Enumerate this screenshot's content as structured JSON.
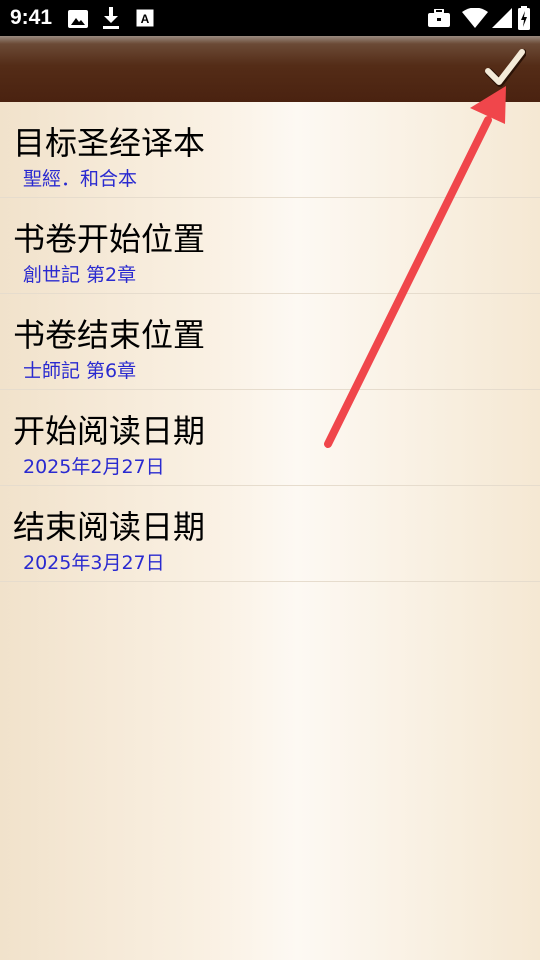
{
  "status_bar": {
    "time": "9:41",
    "left_icons": [
      "image-icon",
      "download-icon",
      "font-a-icon"
    ],
    "right_icons": [
      "briefcase-icon",
      "wifi-icon",
      "cell-signal-icon",
      "battery-charging-icon"
    ]
  },
  "toolbar": {
    "confirm_icon": "check-icon"
  },
  "settings": [
    {
      "title": "目标圣经译本",
      "value": "聖經．和合本"
    },
    {
      "title": "书卷开始位置",
      "value": "創世記 第2章"
    },
    {
      "title": "书卷结束位置",
      "value": "士師記 第6章"
    },
    {
      "title": "开始阅读日期",
      "value": "2025年2月27日"
    },
    {
      "title": "结束阅读日期",
      "value": "2025年3月27日"
    }
  ],
  "colors": {
    "appbar": "#4a2210",
    "value_text": "#2a2ad0",
    "annotation_arrow": "#f0464b",
    "checkmark": "#f3ead8"
  }
}
